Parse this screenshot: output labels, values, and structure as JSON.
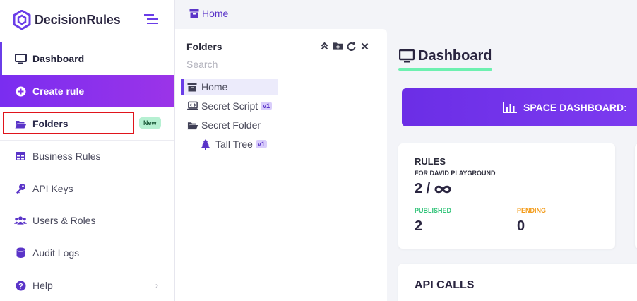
{
  "app": {
    "name": "DecisionRules"
  },
  "sidebar": {
    "items": [
      {
        "label": "Dashboard",
        "icon": "monitor-icon"
      },
      {
        "label": "Create rule",
        "icon": "plus-circle-icon"
      },
      {
        "label": "Folders",
        "icon": "folder-open-icon",
        "badge": "New"
      },
      {
        "label": "Business Rules",
        "icon": "table-icon"
      },
      {
        "label": "API Keys",
        "icon": "key-icon"
      },
      {
        "label": "Users & Roles",
        "icon": "users-icon"
      },
      {
        "label": "Audit Logs",
        "icon": "database-icon"
      },
      {
        "label": "Help",
        "icon": "question-circle-icon"
      }
    ]
  },
  "breadcrumb": {
    "home": "Home"
  },
  "folders_panel": {
    "title": "Folders",
    "search_placeholder": "Search",
    "tree": [
      {
        "label": "Home",
        "icon": "archive-icon"
      },
      {
        "label": "Secret Script",
        "icon": "laptop-code-icon",
        "version": "v1"
      },
      {
        "label": "Secret Folder",
        "icon": "folder-open-icon"
      },
      {
        "label": "Tall Tree",
        "icon": "tree-icon",
        "version": "v1"
      }
    ]
  },
  "dashboard": {
    "title": "Dashboard",
    "space_banner": "SPACE DASHBOARD:",
    "rules_card": {
      "title": "RULES",
      "subtitle": "FOR DAVID PLAYGROUND",
      "count": "2 /",
      "published_label": "PUBLISHED",
      "published_value": "2",
      "pending_label": "PENDING",
      "pending_value": "0"
    },
    "api_calls_title": "API CALLS"
  },
  "colors": {
    "accent": "#6a3de8",
    "highlight": "#e0141b",
    "published": "#33c47a",
    "pending": "#f39a16",
    "underline": "#6ef0b0"
  }
}
